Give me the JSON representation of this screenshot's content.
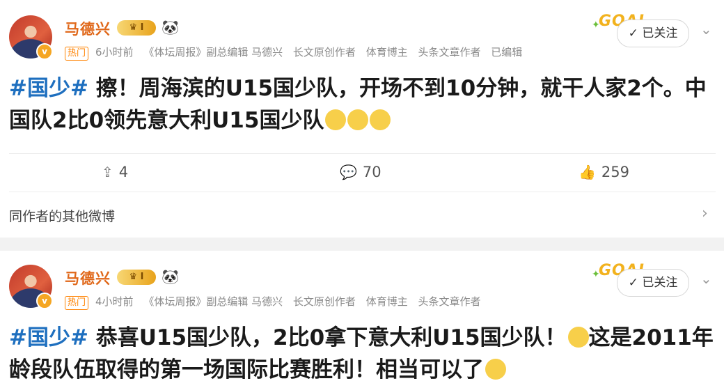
{
  "post1": {
    "username": "马德兴",
    "level_badge": "I",
    "hot_tag": "热门",
    "time": "6小时前",
    "source": "《体坛周报》副总编辑 马德兴",
    "labels": [
      "长文原创作者",
      "体育博主",
      "头条文章作者"
    ],
    "edited": "已编辑",
    "goal_text": "GOAL",
    "follow_label": "已关注",
    "hashtag": "#国少#",
    "text": " 擦！周海滨的U15国少队，开场不到10分钟，就干人家2个。中国队2比0领先意大利U15国少队",
    "repost_count": "4",
    "comment_count": "70",
    "like_count": "259",
    "more_label": "同作者的其他微博"
  },
  "post2": {
    "username": "马德兴",
    "level_badge": "I",
    "hot_tag": "热门",
    "time": "4小时前",
    "source": "《体坛周报》副总编辑 马德兴",
    "labels": [
      "长文原创作者",
      "体育博主",
      "头条文章作者"
    ],
    "goal_text": "GOAL",
    "follow_label": "已关注",
    "hashtag": "#国少#",
    "text": " 恭喜U15国少队，2比0拿下意大利U15国少队！",
    "text2": "这是2011年龄段队伍取得的第一场国际比赛胜利！相当可以了"
  },
  "icons": {
    "repost": "repost-icon",
    "comment": "comment-icon",
    "like": "like-icon"
  },
  "colors": {
    "username": "#e0681a",
    "hashtag": "#1e6fbf",
    "hot": "#ff8200",
    "badge": "#f5a623"
  }
}
